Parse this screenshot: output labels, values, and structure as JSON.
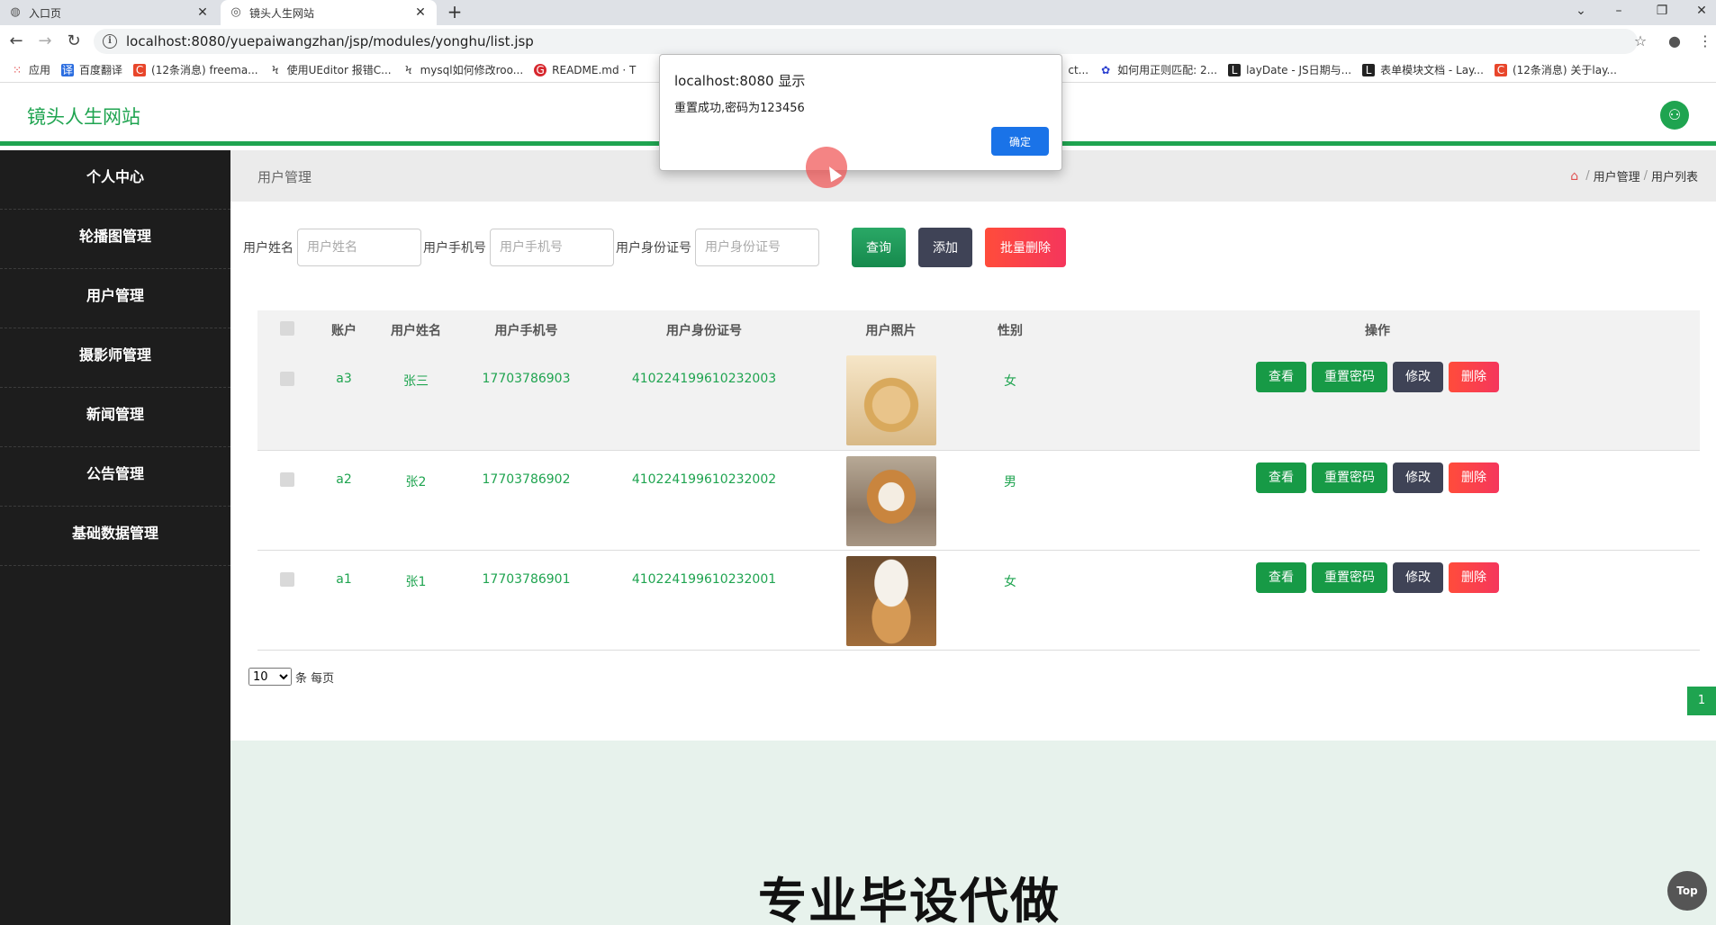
{
  "browser": {
    "tabs": [
      {
        "label": "入口页",
        "icon": "globe-icon"
      },
      {
        "label": "镜头人生网站",
        "icon": "page-icon"
      }
    ],
    "url": "localhost:8080/yuepaiwangzhan/jsp/modules/yonghu/list.jsp",
    "bookmarks": [
      {
        "label": "应用",
        "color": "#e04040"
      },
      {
        "label": "百度翻译",
        "color": "#2b6de0"
      },
      {
        "label": "(12条消息) freema...",
        "color": "#e8462b"
      },
      {
        "label": "使用UEditor 报错C...",
        "color": "#444444"
      },
      {
        "label": "mysql如何修改roo...",
        "color": "#444444"
      },
      {
        "label": "README.md · T",
        "color": "#d7282f"
      },
      {
        "label": "ct...",
        "color": "#ffffff"
      },
      {
        "label": "如何用正则匹配: 2...",
        "color": "#2a3fd0"
      },
      {
        "label": "layDate - JS日期与...",
        "color": "#222222"
      },
      {
        "label": "表单模块文档 - Lay...",
        "color": "#222222"
      },
      {
        "label": "(12条消息) 关于lay...",
        "color": "#e8462b"
      }
    ]
  },
  "app": {
    "title": "镜头人生网站",
    "accent": "#1fa450"
  },
  "sidebar": {
    "items": [
      "个人中心",
      "轮播图管理",
      "用户管理",
      "摄影师管理",
      "新闻管理",
      "公告管理",
      "基础数据管理"
    ]
  },
  "crumb": {
    "title": "用户管理",
    "path": [
      "用户管理",
      "用户列表"
    ]
  },
  "search": {
    "name_label": "用户姓名",
    "name_placeholder": "用户姓名",
    "phone_label": "用户手机号",
    "phone_placeholder": "用户手机号",
    "idcard_label": "用户身份证号",
    "idcard_placeholder": "用户身份证号",
    "query_btn": "查询",
    "add_btn": "添加",
    "batch_delete_btn": "批量删除"
  },
  "table": {
    "headers": [
      "账户",
      "用户姓名",
      "用户手机号",
      "用户身份证号",
      "用户照片",
      "性别",
      "操作"
    ],
    "ops": {
      "view": "查看",
      "reset": "重置密码",
      "edit": "修改",
      "delete": "删除"
    },
    "rows": [
      {
        "account": "a3",
        "name": "张三",
        "phone": "17703786903",
        "idcard": "410224199610232003",
        "photo": "puppy-photo",
        "gender": "女"
      },
      {
        "account": "a2",
        "name": "张2",
        "phone": "17703786902",
        "idcard": "410224199610232002",
        "photo": "shiba-photo",
        "gender": "男"
      },
      {
        "account": "a1",
        "name": "张1",
        "phone": "17703786901",
        "idcard": "410224199610232001",
        "photo": "cat-photo",
        "gender": "女"
      }
    ]
  },
  "pagination": {
    "page_size": "10",
    "page_size_suffix": "条 每页",
    "current_page": "1"
  },
  "watermark": "专业毕设代做",
  "top_btn": "Top",
  "alert": {
    "title": "localhost:8080 显示",
    "message": "重置成功,密码为123456",
    "ok": "确定"
  }
}
